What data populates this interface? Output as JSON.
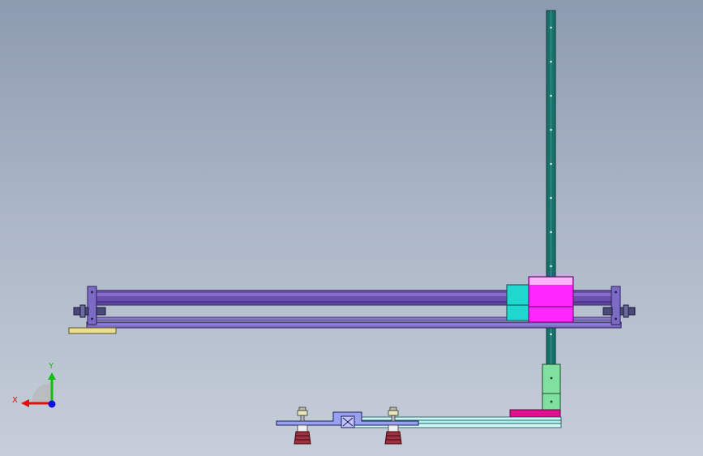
{
  "triad": {
    "x_label": "X",
    "y_label": "Y",
    "x_color": "#e01010",
    "y_color": "#10c010",
    "z_color": "#1010e0"
  },
  "colors": {
    "rail": "#17706a",
    "tube": "#6a4fae",
    "frame": "#7b6bc4",
    "carriage": "#ff26ff",
    "carriage_top": "#ffb3ff",
    "motor": "#20d8d0",
    "bracket": "#80e0a0",
    "plate": "#e01090",
    "base": "#9aa0f0",
    "pad": "#e8e090",
    "slide": "#b0f0f0",
    "cup": "#a03040"
  }
}
